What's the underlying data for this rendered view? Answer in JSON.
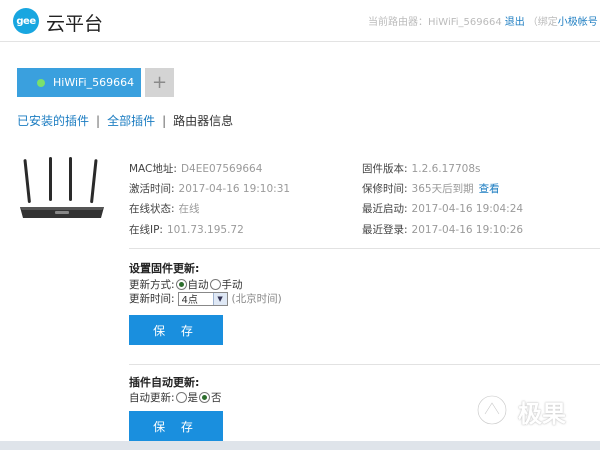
{
  "header": {
    "logo_text": "gee",
    "brand": "云平台",
    "current_router_label": "当前路由器：",
    "current_router_name": "HiWiFi_569664",
    "logout": "退出",
    "bind_prefix": "（绑定",
    "account": "小极帐号"
  },
  "tabs": {
    "active_label": "HiWiFi_569664",
    "add_symbol": "+"
  },
  "subnav": {
    "installed": "已安装的插件",
    "sep1": "|",
    "all": "全部插件",
    "sep2": "|",
    "current": "路由器信息"
  },
  "router_info": {
    "mac_label": "MAC地址:",
    "mac_value": "D4EE07569664",
    "activated_label": "激活时间:",
    "activated_value": "2017-04-16 19:10:31",
    "online_label": "在线状态:",
    "online_value": "在线",
    "ip_label": "在线IP:",
    "ip_value": "101.73.195.72",
    "firmware_label": "固件版本:",
    "firmware_value": "1.2.6.17708s",
    "warranty_label": "保修时间:",
    "warranty_value": "365天后到期",
    "warranty_link": "查看",
    "last_start_label": "最近启动:",
    "last_start_value": "2017-04-16 19:04:24",
    "last_login_label": "最近登录:",
    "last_login_value": "2017-04-16 19:10:26"
  },
  "firmware_update": {
    "title": "设置固件更新:",
    "mode_label": "更新方式:",
    "mode_auto": "自动",
    "mode_manual": "手动",
    "mode_selected": "自动",
    "time_label": "更新时间:",
    "time_value": "4点",
    "time_note": "(北京时间)",
    "save": "保 存"
  },
  "plugin_update": {
    "title": "插件自动更新:",
    "auto_label": "自动更新:",
    "yes": "是",
    "no": "否",
    "selected": "否",
    "save": "保 存"
  },
  "watermark": {
    "text": "极果"
  },
  "colors": {
    "accent": "#1a8fde",
    "tab": "#3aa0de",
    "link": "#1b7cc1",
    "online_dot": "#7ae06c"
  }
}
